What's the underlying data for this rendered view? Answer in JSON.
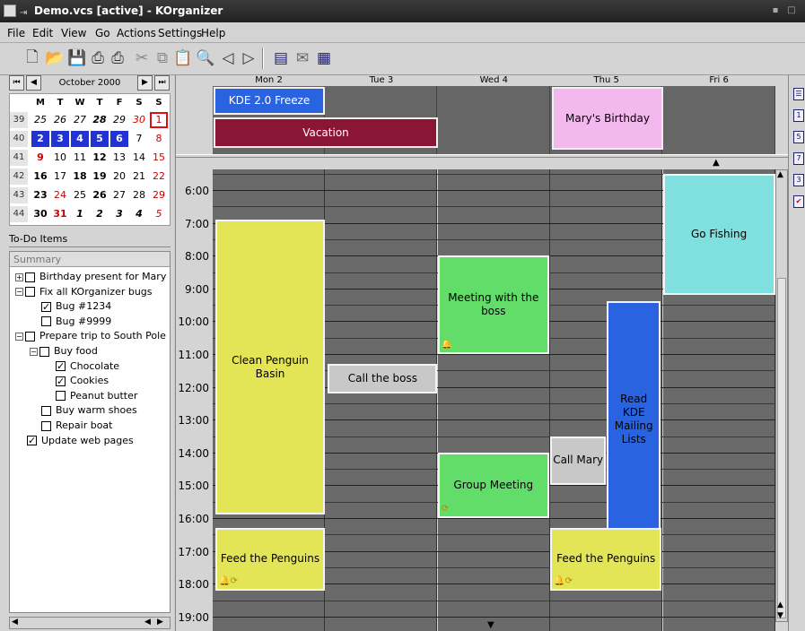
{
  "window": {
    "title": "Demo.vcs [active] - KOrganizer"
  },
  "menu": [
    "File",
    "Edit",
    "View",
    "Go",
    "Actions",
    "Settings",
    "Help"
  ],
  "toolbar": {
    "icons": [
      "new-icon",
      "open-icon",
      "save-icon",
      "print-icon",
      "print-preview-icon",
      "cut-icon",
      "copy-icon",
      "paste-icon",
      "search-icon",
      "previous-icon",
      "next-icon",
      "day-view-icon",
      "week-view-icon",
      "month-view-icon"
    ]
  },
  "navigator": {
    "month_label": "October 2000",
    "buttons": [
      "⏮",
      "◀",
      "▶",
      "⏭"
    ],
    "dow": [
      "M",
      "T",
      "W",
      "T",
      "F",
      "S",
      "S"
    ],
    "weeks": [
      {
        "num": "39",
        "days": [
          "25",
          "26",
          "27",
          "28",
          "29",
          "30",
          "1"
        ]
      },
      {
        "num": "40",
        "days": [
          "2",
          "3",
          "4",
          "5",
          "6",
          "7",
          "8"
        ]
      },
      {
        "num": "41",
        "days": [
          "9",
          "10",
          "11",
          "12",
          "13",
          "14",
          "15"
        ]
      },
      {
        "num": "42",
        "days": [
          "16",
          "17",
          "18",
          "19",
          "20",
          "21",
          "22"
        ]
      },
      {
        "num": "43",
        "days": [
          "23",
          "24",
          "25",
          "26",
          "27",
          "28",
          "29"
        ]
      },
      {
        "num": "44",
        "days": [
          "30",
          "31",
          "1",
          "2",
          "3",
          "4",
          "5"
        ]
      }
    ]
  },
  "todo": {
    "title": "To-Do Items",
    "header": "Summary",
    "items": [
      {
        "label": "Birthday present for Mary",
        "checked": false,
        "level": 0,
        "expander": "+"
      },
      {
        "label": "Fix all KOrganizer bugs",
        "checked": false,
        "level": 0,
        "expander": "−"
      },
      {
        "label": "Bug #1234",
        "checked": true,
        "level": 1,
        "expander": ""
      },
      {
        "label": "Bug #9999",
        "checked": false,
        "level": 1,
        "expander": ""
      },
      {
        "label": "Prepare trip to South Pole",
        "checked": false,
        "level": 0,
        "expander": "−"
      },
      {
        "label": "Buy food",
        "checked": false,
        "level": 1,
        "expander": "−"
      },
      {
        "label": "Chocolate",
        "checked": true,
        "level": 2,
        "expander": ""
      },
      {
        "label": "Cookies",
        "checked": true,
        "level": 2,
        "expander": ""
      },
      {
        "label": "Peanut butter",
        "checked": false,
        "level": 2,
        "expander": ""
      },
      {
        "label": "Buy warm shoes",
        "checked": false,
        "level": 1,
        "expander": ""
      },
      {
        "label": "Repair boat",
        "checked": false,
        "level": 1,
        "expander": ""
      },
      {
        "label": "Update web pages",
        "checked": true,
        "level": 0,
        "expander": ""
      }
    ]
  },
  "agenda": {
    "days": [
      "Mon 2",
      "Tue 3",
      "Wed 4",
      "Thu 5",
      "Fri 6"
    ],
    "hours": [
      "6:00",
      "7:00",
      "8:00",
      "9:00",
      "10:00",
      "11:00",
      "12:00",
      "13:00",
      "14:00",
      "15:00",
      "16:00",
      "17:00",
      "18:00",
      "19:00"
    ],
    "allday_events": [
      {
        "title": "KDE 2.0 Freeze",
        "color": "#2a63e0",
        "text_color": "#ffffff"
      },
      {
        "title": "Vacation",
        "color": "#8b1535",
        "text_color": "#ffffff"
      },
      {
        "title": "Mary's Birthday",
        "color": "#f3b8ee",
        "text_color": "#000000"
      }
    ],
    "events": [
      {
        "title": "Clean Penguin Basin",
        "color": "#e4e457",
        "text_color": "#000000",
        "icons": ""
      },
      {
        "title": "Feed the Penguins",
        "color": "#e4e457",
        "text_color": "#000000",
        "icons": "🔔⟳"
      },
      {
        "title": "Call the boss",
        "color": "#c8c8c8",
        "text_color": "#000000",
        "icons": ""
      },
      {
        "title": "Meeting with the boss",
        "color": "#63dd6a",
        "text_color": "#000000",
        "icons": "🔔"
      },
      {
        "title": "Group Meeting",
        "color": "#63dd6a",
        "text_color": "#000000",
        "icons": "⟳"
      },
      {
        "title": "Call Mary",
        "color": "#c8c8c8",
        "text_color": "#000000",
        "icons": ""
      },
      {
        "title": "Read KDE Mailing Lists",
        "color": "#2a63e0",
        "text_color": "#000000",
        "icons": ""
      },
      {
        "title": "Feed the Penguins",
        "color": "#e4e457",
        "text_color": "#000000",
        "icons": "🔔⟳"
      },
      {
        "title": "Go Fishing",
        "color": "#80e0e0",
        "text_color": "#000000",
        "icons": ""
      }
    ]
  },
  "colors": {
    "grid": "#6a6a6a",
    "selection": "#2233d4",
    "weekend": "#cc0000"
  }
}
